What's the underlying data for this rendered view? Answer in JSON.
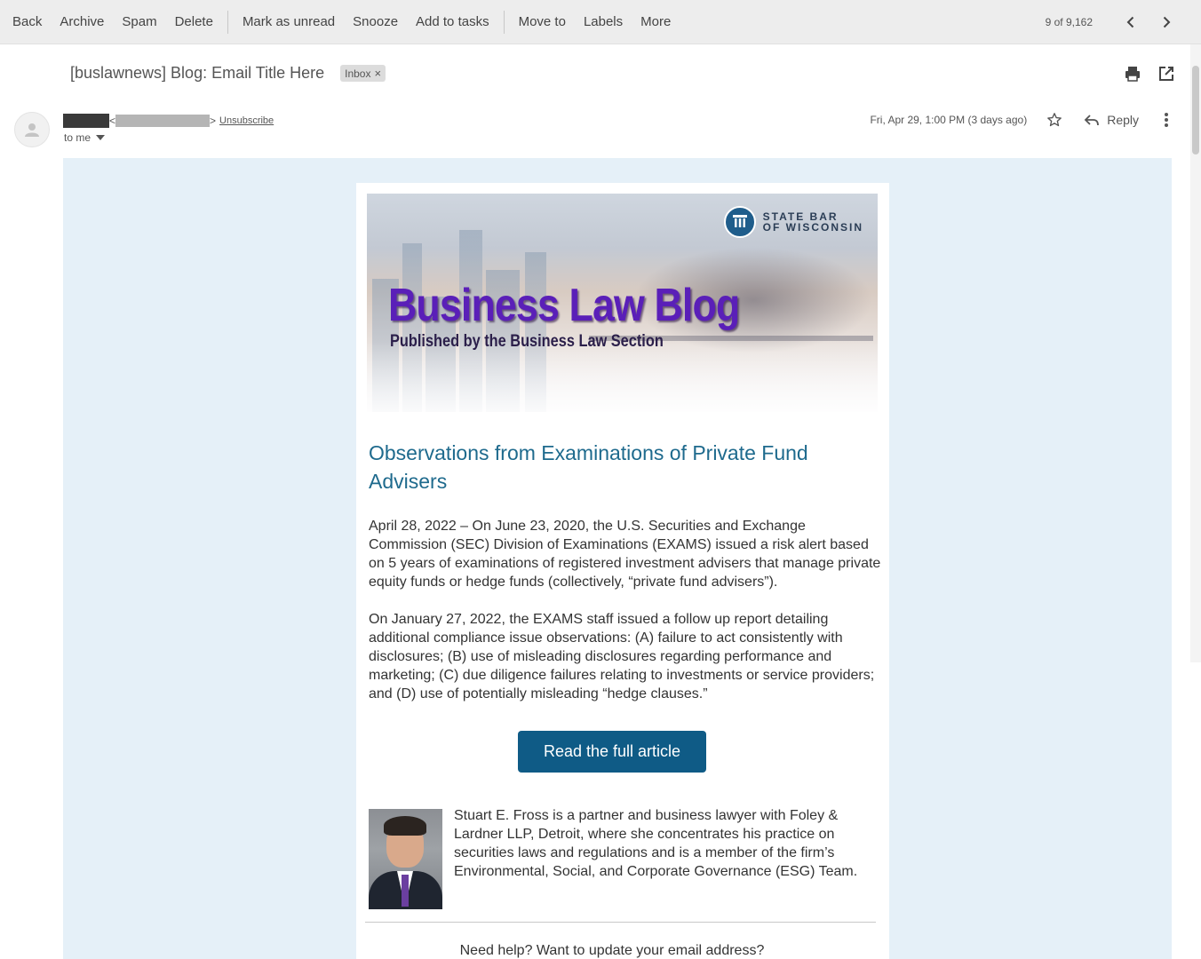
{
  "toolbar": {
    "back": "Back",
    "archive": "Archive",
    "spam": "Spam",
    "delete": "Delete",
    "mark_unread": "Mark as unread",
    "snooze": "Snooze",
    "add_tasks": "Add to tasks",
    "move_to": "Move to",
    "labels": "Labels",
    "more": "More",
    "count": "9 of 9,162"
  },
  "message": {
    "subject": "[buslawnews] Blog: Email Title Here",
    "label_chip": "Inbox",
    "unsubscribe": "Unsubscribe",
    "to": "to me",
    "date": "Fri, Apr 29, 1:00 PM (3 days ago)",
    "reply": "Reply"
  },
  "email": {
    "logo_line1": "STATE BAR",
    "logo_line2": "OF WISCONSIN",
    "blog_title": "Business Law Blog",
    "blog_subtitle": "Published by the Business Law Section",
    "article_title": "Observations from Examinations of Private Fund Advisers",
    "para1": "April 28, 2022 – On June 23, 2020, the U.S. Securities and Exchange Commission (SEC) Division of Examinations (EXAMS) issued a risk alert based on 5 years of examinations of registered investment advisers that manage private equity funds or hedge funds (collectively, “private fund advisers”).",
    "para2": "On January 27, 2022, the EXAMS staff issued a follow up report detailing additional compliance issue observations: (A) failure to act consistently with disclosures; (B) use of misleading disclosures regarding performance and marketing; (C) due diligence failures relating to investments or service providers; and (D) use of potentially misleading “hedge clauses.”",
    "cta": "Read the full article",
    "bio": "Stuart E. Fross is a partner and business lawyer with Foley & Lardner LLP, Detroit, where she concentrates his practice on securities laws and regulations and is a member of the firm’s Environmental, Social, and Corporate Governance (ESG) Team.",
    "help": "Need help? Want to update your email address?"
  },
  "colors": {
    "toolbar_bg": "#ededed",
    "email_bg": "#e5f0f8",
    "title_blue": "#1e6a8d",
    "button_blue": "#0f5b86",
    "blog_purple": "#5a1fb8"
  }
}
